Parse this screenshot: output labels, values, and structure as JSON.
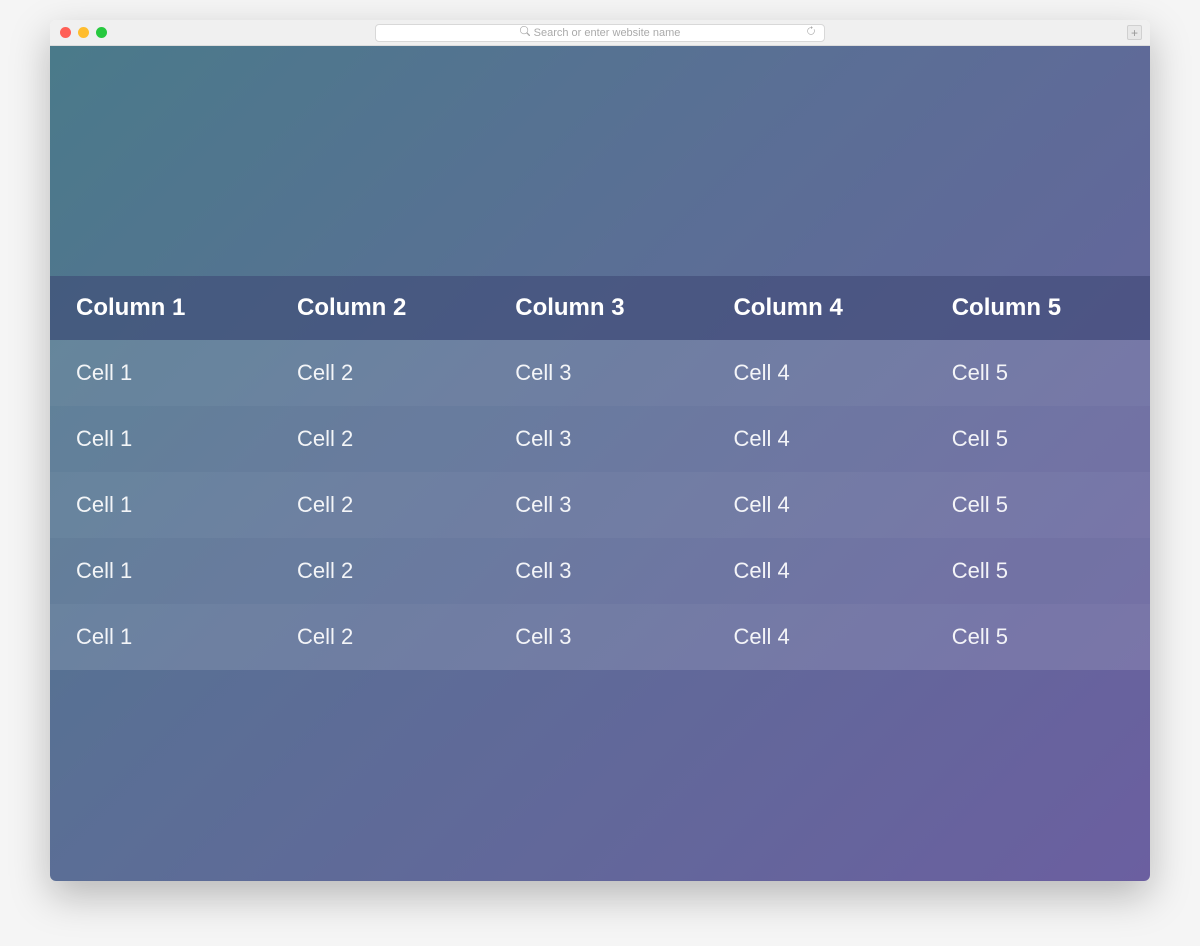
{
  "browser": {
    "url_placeholder": "Search or enter website name"
  },
  "table": {
    "headers": [
      "Column 1",
      "Column 2",
      "Column 3",
      "Column 4",
      "Column 5"
    ],
    "rows": [
      [
        "Cell 1",
        "Cell 2",
        "Cell 3",
        "Cell 4",
        "Cell 5"
      ],
      [
        "Cell 1",
        "Cell 2",
        "Cell 3",
        "Cell 4",
        "Cell 5"
      ],
      [
        "Cell 1",
        "Cell 2",
        "Cell 3",
        "Cell 4",
        "Cell 5"
      ],
      [
        "Cell 1",
        "Cell 2",
        "Cell 3",
        "Cell 4",
        "Cell 5"
      ],
      [
        "Cell 1",
        "Cell 2",
        "Cell 3",
        "Cell 4",
        "Cell 5"
      ]
    ]
  },
  "colors": {
    "gradient_start": "#4a7a8a",
    "gradient_mid": "#5a6f95",
    "gradient_end": "#6b5fa0",
    "header_overlay": "rgba(60, 70, 115, 0.55)",
    "row_overlay": "rgba(255, 255, 255, 0.12)"
  }
}
